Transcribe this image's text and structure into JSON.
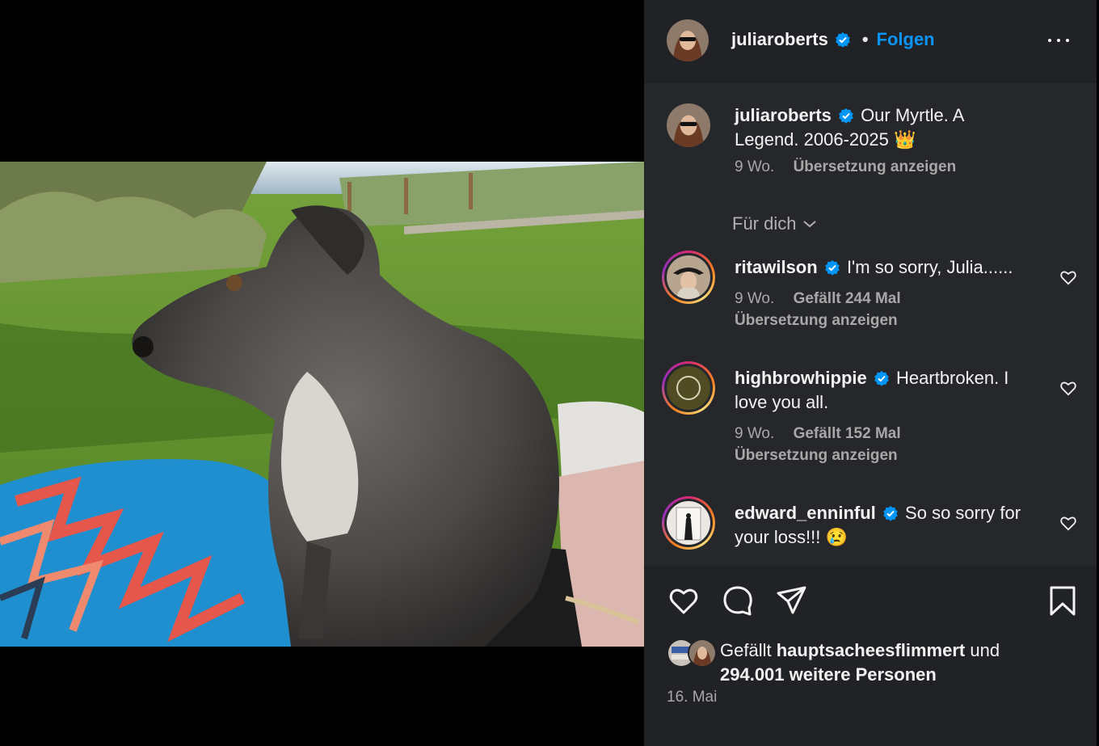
{
  "post": {
    "username": "juliaroberts",
    "follow_label": "Folgen",
    "separator": "•",
    "caption": "Our Myrtle. A Legend. 2006-2025 👑",
    "time": "9 Wo.",
    "translate_label": "Übersetzung anzeigen"
  },
  "filter": {
    "label": "Für dich"
  },
  "comments": [
    {
      "username": "ritawilson",
      "text": "I'm so sorry, Julia......",
      "time": "9 Wo.",
      "likes": "Gefällt 244 Mal",
      "translate": "Übersetzung anzeigen"
    },
    {
      "username": "highbrowhippie",
      "text": "Heartbroken. I love you all.",
      "time": "9 Wo.",
      "likes": "Gefällt 152 Mal",
      "translate": "Übersetzung anzeigen"
    },
    {
      "username": "edward_enninful",
      "text": "So so sorry for your loss!!! 😢"
    }
  ],
  "likes": {
    "prefix": "Gefällt",
    "user": "hauptsacheesflimmert",
    "conj": "und",
    "count": "294.001 weitere Personen"
  },
  "date": "16. Mai",
  "colors": {
    "accent": "#0a95f6",
    "panel": "#25272b",
    "verified": "#0095f6"
  },
  "icons": [
    "more-icon",
    "verified-icon",
    "chevron-down-icon",
    "heart-icon",
    "comment-icon",
    "share-icon",
    "bookmark-icon"
  ]
}
